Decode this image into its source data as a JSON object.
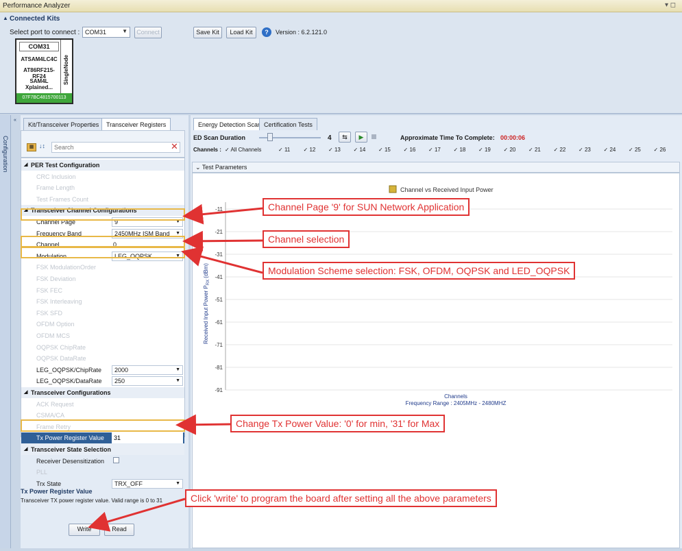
{
  "window": {
    "title": "Performance Analyzer",
    "controls": "▾ ◻"
  },
  "connected_kits": {
    "title": "Connected Kits",
    "select_port_label": "Select port to connect :",
    "port_value": "COM31",
    "connect_label": "Connect",
    "save_kit_label": "Save Kit",
    "load_kit_label": "Load Kit",
    "version": "Version : 6.2.121.0",
    "kit_card": {
      "port": "COM31",
      "lines": [
        "ATSAM4LC4C",
        "AT86RF215-RF24",
        "SAM4L Xplained..."
      ],
      "ieee": "07F7BC4815700113",
      "mode": "SingleNode"
    }
  },
  "sidebar": {
    "label": "Configuration"
  },
  "props": {
    "tabs": [
      "Kit/Transceiver Properties",
      "Transceiver Registers"
    ],
    "search_placeholder": "Search",
    "rows": [
      {
        "kind": "cat",
        "name": "PER Test Configuration"
      },
      {
        "kind": "dim",
        "name": "CRC Inclusion"
      },
      {
        "kind": "dim",
        "name": "Frame Length"
      },
      {
        "kind": "dim",
        "name": "Test Frames Count"
      },
      {
        "kind": "cat",
        "name": "Transceiver Channel Configurations"
      },
      {
        "kind": "sel",
        "name": "Channel Page",
        "value": "9"
      },
      {
        "kind": "sel",
        "name": "Frequency Band",
        "value": "2450MHz ISM Band"
      },
      {
        "kind": "val",
        "name": "Channel",
        "value": "0"
      },
      {
        "kind": "sel",
        "name": "Modulation",
        "value": "LEG_OQPSK"
      },
      {
        "kind": "dim",
        "name": "FSK ModulationOrder"
      },
      {
        "kind": "dim",
        "name": "FSK Deviation"
      },
      {
        "kind": "dim",
        "name": "FSK FEC"
      },
      {
        "kind": "dim",
        "name": "FSK Interleaving"
      },
      {
        "kind": "dim",
        "name": "FSK SFD"
      },
      {
        "kind": "dim",
        "name": "OFDM Option"
      },
      {
        "kind": "dim",
        "name": "OFDM MCS"
      },
      {
        "kind": "dim",
        "name": "OQPSK ChipRate"
      },
      {
        "kind": "dim",
        "name": "OQPSK DataRate"
      },
      {
        "kind": "sel",
        "name": "LEG_OQPSK/ChipRate",
        "value": "2000"
      },
      {
        "kind": "sel",
        "name": "LEG_OQPSK/DataRate",
        "value": "250"
      },
      {
        "kind": "cat",
        "name": "Transceiver Configurations"
      },
      {
        "kind": "dim",
        "name": "ACK Request"
      },
      {
        "kind": "dim",
        "name": "CSMA/CA"
      },
      {
        "kind": "dim",
        "name": "Frame Retry"
      },
      {
        "kind": "hlsel",
        "name": "Tx Power Register Value",
        "value": "31"
      },
      {
        "kind": "cat",
        "name": "Transceiver State Selection"
      },
      {
        "kind": "chk",
        "name": "Receiver Desensitization"
      },
      {
        "kind": "dim",
        "name": "PLL"
      },
      {
        "kind": "sel",
        "name": "Trx State",
        "value": "TRX_OFF"
      }
    ],
    "desc_title": "Tx Power Register Value",
    "desc_body": "Transceiver TX power register value. Valid range is 0 to 31",
    "write_label": "Write",
    "read_label": "Read"
  },
  "ed": {
    "tabs": [
      "Energy Detection Scan",
      "Certification Tests"
    ],
    "duration_label": "ED Scan Duration",
    "duration_value": "4",
    "time_label": "Approximate Time To Complete:",
    "time_value": "00:00:06",
    "channels_label": "Channels :",
    "all_channels": "All Channels",
    "channels": [
      "11",
      "12",
      "13",
      "14",
      "15",
      "16",
      "17",
      "18",
      "19",
      "20",
      "21",
      "22",
      "23",
      "24",
      "25",
      "26"
    ],
    "test_params": "Test Parameters"
  },
  "chart_data": {
    "type": "bar",
    "title": "Channel vs Received Input Power",
    "legend": "Channel vs Received Input Power",
    "xlabel": "Channels",
    "xsublabel": "Frequency Range : 2405MHz - 2480MHZ",
    "ylabel": "Received Input Power P",
    "ylabel_sub": "RX",
    "ylabel_unit": "(dBm)",
    "yticks": [
      "-11",
      "-21",
      "-31",
      "-41",
      "-51",
      "-61",
      "-71",
      "-81",
      "-91"
    ],
    "ylim": [
      -91,
      -11
    ],
    "values": [],
    "colors": {
      "legend": "#d6b43a",
      "grid": "#e5e5e5"
    }
  },
  "annotations": [
    {
      "id": "ann-channel-page",
      "text": "Channel Page '9' for SUN Network Application"
    },
    {
      "id": "ann-channel",
      "text": "Channel selection"
    },
    {
      "id": "ann-modulation",
      "text": "Modulation Scheme selection: FSK, OFDM, OQPSK and LED_OQPSK"
    },
    {
      "id": "ann-txpower",
      "text": "Change Tx Power Value: '0' for min, '31' for Max"
    },
    {
      "id": "ann-write",
      "text": "Click 'write' to program the board after setting all the above parameters"
    }
  ]
}
